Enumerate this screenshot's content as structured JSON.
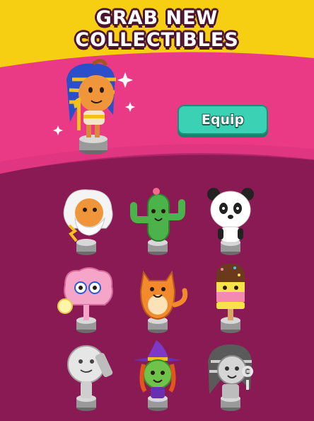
{
  "header": {
    "title_line1": "GRAB NEW",
    "title_line2": "COLLECTIBLES"
  },
  "featured": {
    "icon": "pharaoh-collectible-icon"
  },
  "actions": {
    "equip_label": "Equip"
  },
  "collectibles": [
    {
      "icon": "zeus-collectible-icon"
    },
    {
      "icon": "cactus-collectible-icon"
    },
    {
      "icon": "panda-collectible-icon"
    },
    {
      "icon": "brain-collectible-icon"
    },
    {
      "icon": "cat-collectible-icon"
    },
    {
      "icon": "popsicle-collectible-icon"
    },
    {
      "icon": "moon-collectible-icon"
    },
    {
      "icon": "witch-collectible-icon"
    },
    {
      "icon": "pharaoh-locked-collectible-icon"
    }
  ],
  "colors": {
    "yellow_bg": "#f6ce12",
    "pink_band": "#ea3a86",
    "purple_bg": "#8a1a54",
    "equip_button": "#3ad1b4"
  }
}
